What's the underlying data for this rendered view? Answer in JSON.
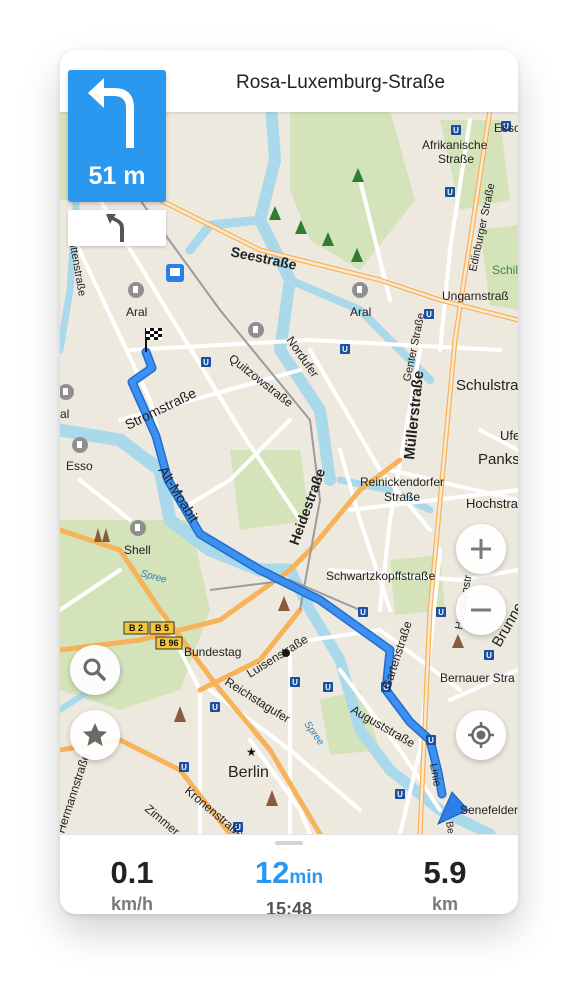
{
  "header": {
    "street_name": "Rosa-Luxemburg-Straße"
  },
  "maneuver": {
    "distance": "51 m",
    "icon": "turn-left-arrow-icon",
    "next_icon": "slight-left-arrow-icon"
  },
  "map": {
    "labels": {
      "afrikanische": "Afrikanische",
      "strasse": "Straße",
      "esso_top": "Esso",
      "edinburger": "Edinburger Straße",
      "schil": "Schil",
      "seestrasse": "Seestraße",
      "ungarnstrasse": "Ungarnstraß",
      "huttenstrasse": "Huttenstraße",
      "aral_left": "Aral",
      "aral_right": "Aral",
      "genter": "Genter Straße",
      "nordufer": "Nordufer",
      "quitzowstrasse": "Quitzowstraße",
      "schulstrasse": "Schulstra",
      "stromstrasse": "Stromstraße",
      "mullerstrasse": "Müllerstraße",
      "ufe": "Ufe",
      "panks": "Panks",
      "al": "al",
      "esso_left": "Esso",
      "alt_moabit": "Alt-Moabit",
      "heidestrasse": "Heidestraße",
      "reinickendorfer": "Reinickendorfer",
      "reinickendorfer2": "Straße",
      "hochstrasse": "Hochstra",
      "shell": "Shell",
      "spree1": "Spree",
      "schwartzkopff": "Schwartzkopffstraße",
      "hussitenstrasse": "Hussitenstr",
      "b2": "B 2",
      "b5": "B 5",
      "b96": "B 96",
      "bundestag": "Bundestag",
      "luisenstrasse": "Luisenstraße",
      "gartenstrasse": "Gartenstraße",
      "brunnen": "Brunne",
      "bernauer": "Bernauer Stra",
      "reichstagufer": "Reichstagufer",
      "auguststrasse": "Auguststraße",
      "spree2": "Spree",
      "berlin": "Berlin",
      "linie": "Linie",
      "zimmer": "Zimmer",
      "kronenstrasse": "Kronenstraße",
      "hermann": "Hermannstraße",
      "senefelder": "Senefelder",
      "be": "Be",
      "u": "U"
    }
  },
  "controls": {
    "zoom_in": "+",
    "zoom_out": "−"
  },
  "stats": {
    "speed_value": "0.1",
    "speed_unit": "km/h",
    "eta_value": "12",
    "eta_unit": "min",
    "arrival_time": "15:48",
    "distance_value": "5.9",
    "distance_unit": "km"
  },
  "colors": {
    "route": "#2b7fe8",
    "accent": "#2b98ef",
    "water": "#a9d9ea",
    "park": "#d4e3b9",
    "major_road": "#f7b35a",
    "land": "#ede9df"
  }
}
